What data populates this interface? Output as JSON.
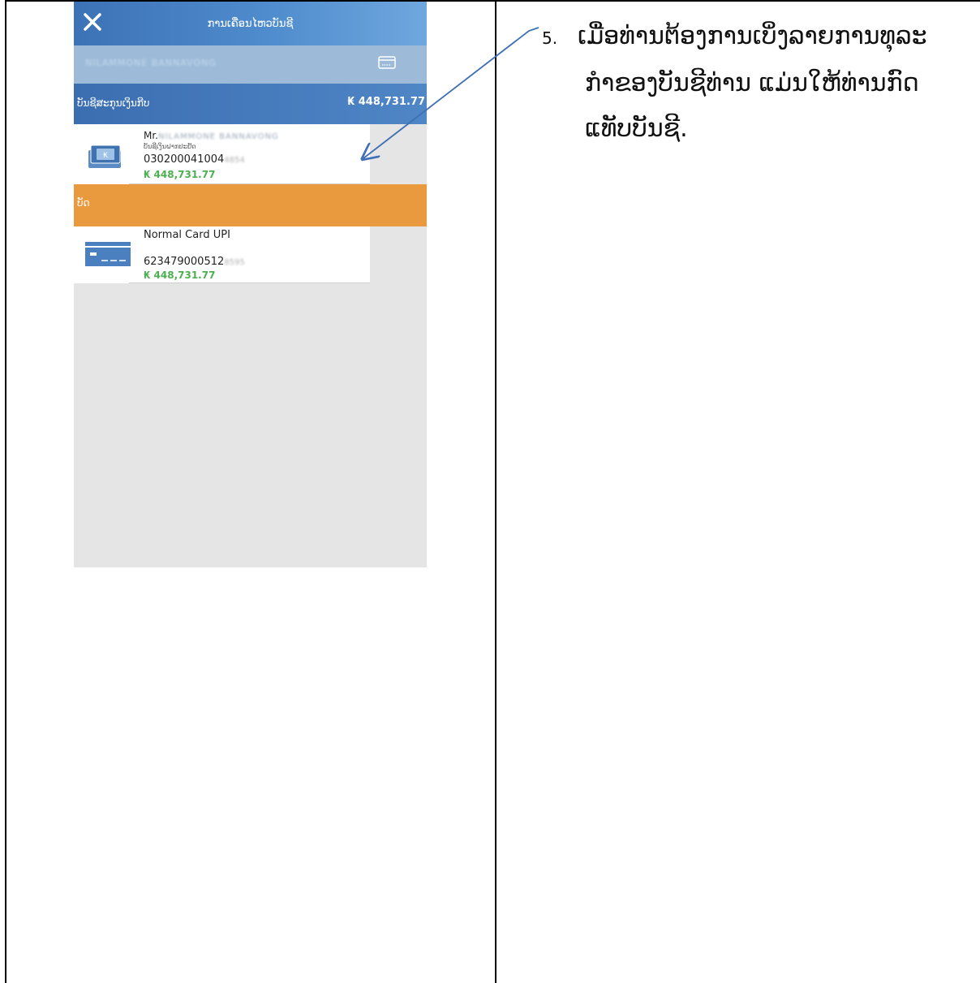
{
  "app": {
    "header_title": "ການເຄື່ອນໄຫວບັນຊີ",
    "account_holder_bar": "NILAMMONE BANNAVONG"
  },
  "savings_section": {
    "label": "ບັນຊີສະກຸນເງິນກີບ",
    "total": "₭ 448,731.77"
  },
  "account_item": {
    "title_prefix": "Mr.",
    "holder_name_blurred": "NILAMMONE BANNAVONG",
    "account_type": "ບັນຊີເງິນຝາກປະຢັດ",
    "account_number_visible": "030200041004",
    "account_number_blurred": "4854",
    "balance": "₭ 448,731.77"
  },
  "card_section": {
    "label": "ບັດ"
  },
  "card_item": {
    "name": "Normal Card UPI",
    "card_number_visible": "623479000512",
    "card_number_blurred": "8595",
    "balance": "₭ 448,731.77"
  },
  "instruction": {
    "step_number": "5.",
    "line1": "ເມື່ອທ່ານຕ້ອງການເບິ່ງລາຍການທຸລະ",
    "line2": "ກຳຂອງບັນຊີທ່ານ ແມ່ນໃຫ້ທ່ານກົດ",
    "line3": "ແທັບບັນຊີ."
  },
  "colors": {
    "header_blue": "#4f8ccd",
    "savings_blue": "#3b6eb1",
    "card_orange": "#e99a3e",
    "balance_green": "#4caf50",
    "arrow_blue": "#3f6fb5"
  },
  "icons": [
    "close-icon",
    "credit-card-icon",
    "bank-account-icon",
    "debit-card-icon"
  ]
}
